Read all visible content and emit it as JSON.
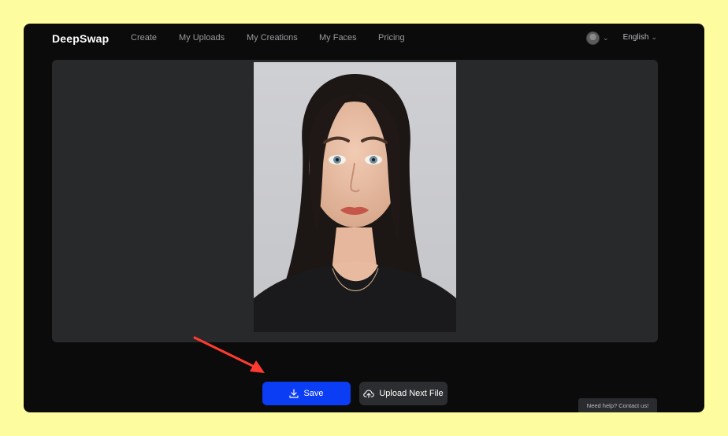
{
  "app": {
    "logo": "DeepSwap"
  },
  "nav": {
    "items": [
      {
        "label": "Create"
      },
      {
        "label": "My Uploads"
      },
      {
        "label": "My Creations"
      },
      {
        "label": "My Faces"
      },
      {
        "label": "Pricing"
      }
    ],
    "language": "English"
  },
  "actions": {
    "save_label": "Save",
    "upload_label": "Upload Next File"
  },
  "help": {
    "label": "Need help? Contact us!"
  },
  "colors": {
    "background": "#fdfd9f",
    "window": "#0b0b0c",
    "panel": "#28292b",
    "save": "#0b3df5",
    "arrow": "#ff3b2f"
  },
  "icons": [
    "avatar-icon",
    "chevron-down-icon",
    "download-icon",
    "cloud-upload-icon",
    "annotation-arrow"
  ]
}
